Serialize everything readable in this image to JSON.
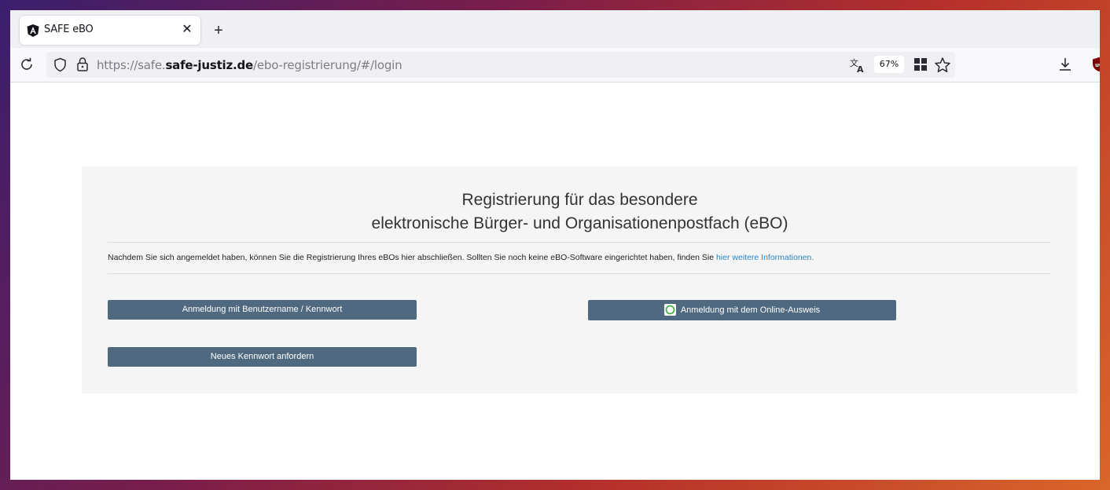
{
  "browser": {
    "tab_title": "SAFE eBO",
    "tab_close": "✕",
    "new_tab": "+",
    "url_prefix": "https://safe.",
    "url_domain": "safe-justiz.de",
    "url_path": "/ebo-registrierung/#/login",
    "zoom": "67%"
  },
  "page": {
    "heading_line1": "Registrierung für das besondere",
    "heading_line2": "elektronische Bürger- und Organisationenpostfach (eBO)",
    "info_text": "Nachdem Sie sich angemeldet haben, können Sie die Registrierung Ihres eBOs hier abschließen. Sollten Sie noch keine eBO-Software eingerichtet haben, finden Sie ",
    "info_link": "hier weitere Informationen."
  },
  "buttons": {
    "login": "Anmeldung mit Benutzername / Kennwort",
    "online_id": "Anmeldung mit dem Online-Ausweis",
    "new_password": "Neues Kennwort anfordern"
  },
  "colors": {
    "button_bg": "#4f6a80",
    "link": "#2a85c5",
    "panel_bg": "#f5f5f5"
  },
  "icons": [
    "angular-favicon-icon",
    "close-icon",
    "plus-icon",
    "reload-icon",
    "shield-icon",
    "lock-icon",
    "translate-icon",
    "reader-view-icon",
    "star-icon",
    "download-icon",
    "ublock-extension-icon",
    "online-ausweis-icon"
  ]
}
